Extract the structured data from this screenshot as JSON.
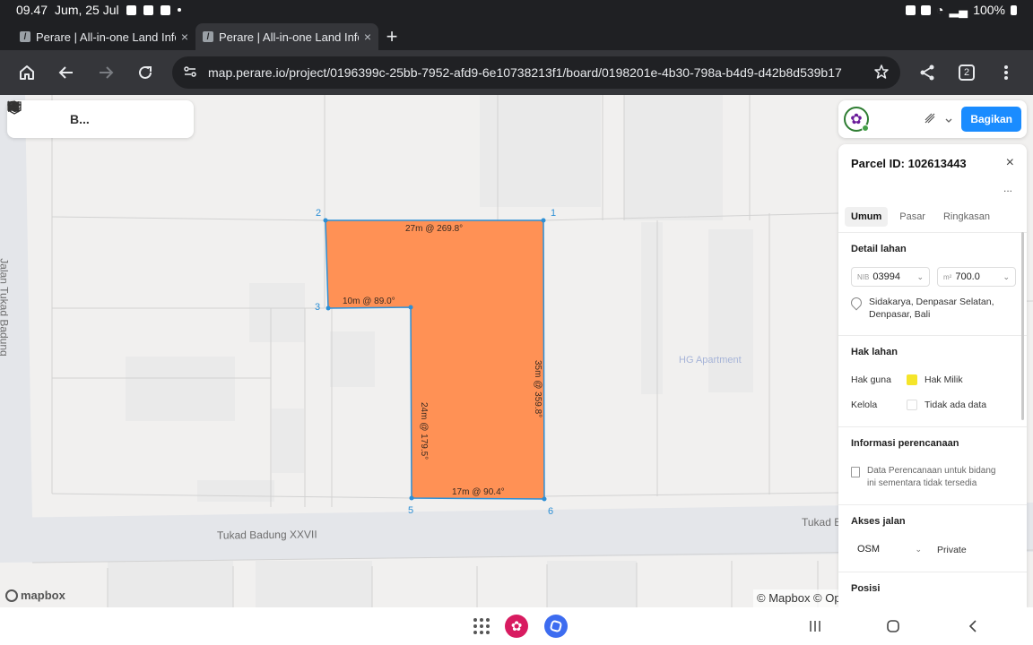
{
  "status_bar": {
    "time": "09.47",
    "date": "Jum, 25 Jul",
    "battery": "100%"
  },
  "tabs": [
    {
      "title": "Perare | All-in-one Land Info",
      "close": "×"
    },
    {
      "title": "Perare | All-in-one Land Info",
      "close": "×"
    }
  ],
  "browser": {
    "url": "map.perare.io/project/0196399c-25bb-7952-afd9-6e10738213f1/board/0198201e-4b30-798a-b4d9-d42b8d539b17",
    "tab_count": "2",
    "new_tab": "+"
  },
  "map_toolbar": {
    "project_label": "B..."
  },
  "map": {
    "roads": {
      "bottom": "Tukad Badung XXVII",
      "bottom_right": "Tukad B",
      "left_vertical": "Jalan Tukad Badung"
    },
    "poi": "HG Apartment",
    "mapbox_logo": "mapbox",
    "attribution": "© Mapbox © Op"
  },
  "parcel_drawing": {
    "vertices": [
      {
        "label": "1"
      },
      {
        "label": "2"
      },
      {
        "label": "3"
      },
      {
        "label": "5"
      },
      {
        "label": "6"
      }
    ],
    "edges": [
      {
        "text": "27m @ 269.8°"
      },
      {
        "text": "10m @ 89.0°"
      },
      {
        "text": "24m @ 179.5°"
      },
      {
        "text": "17m @ 90.4°"
      },
      {
        "text": "35m @ 359.8°"
      }
    ],
    "fill_color": "#ff9155",
    "stroke_color": "#2d8fd5"
  },
  "top_right": {
    "share_label": "Bagikan"
  },
  "panel": {
    "title": "Parcel ID: 102613443",
    "close": "×",
    "more": "...",
    "tabs": [
      "Umum",
      "Pasar",
      "Ringkasan"
    ],
    "detail": {
      "title": "Detail lahan",
      "nib_prefix": "NIB",
      "nib_value": "03994",
      "area_prefix": "m²",
      "area_value": "700.0",
      "address_line1": "Sidakarya, Denpasar Selatan,",
      "address_line2": "Denpasar, Bali"
    },
    "rights": {
      "title": "Hak lahan",
      "hak_guna_label": "Hak guna",
      "hak_guna_value": "Hak Milik",
      "hak_guna_color": "#f5e52a",
      "kelola_label": "Kelola",
      "kelola_value": "Tidak ada data"
    },
    "planning": {
      "title": "Informasi perencanaan",
      "note_line1": "Data Perencanaan untuk bidang",
      "note_line2": "ini sementara tidak tersedia"
    },
    "road_access": {
      "title": "Akses jalan",
      "source": "OSM",
      "value": "Private"
    },
    "position": {
      "title": "Posisi"
    }
  }
}
